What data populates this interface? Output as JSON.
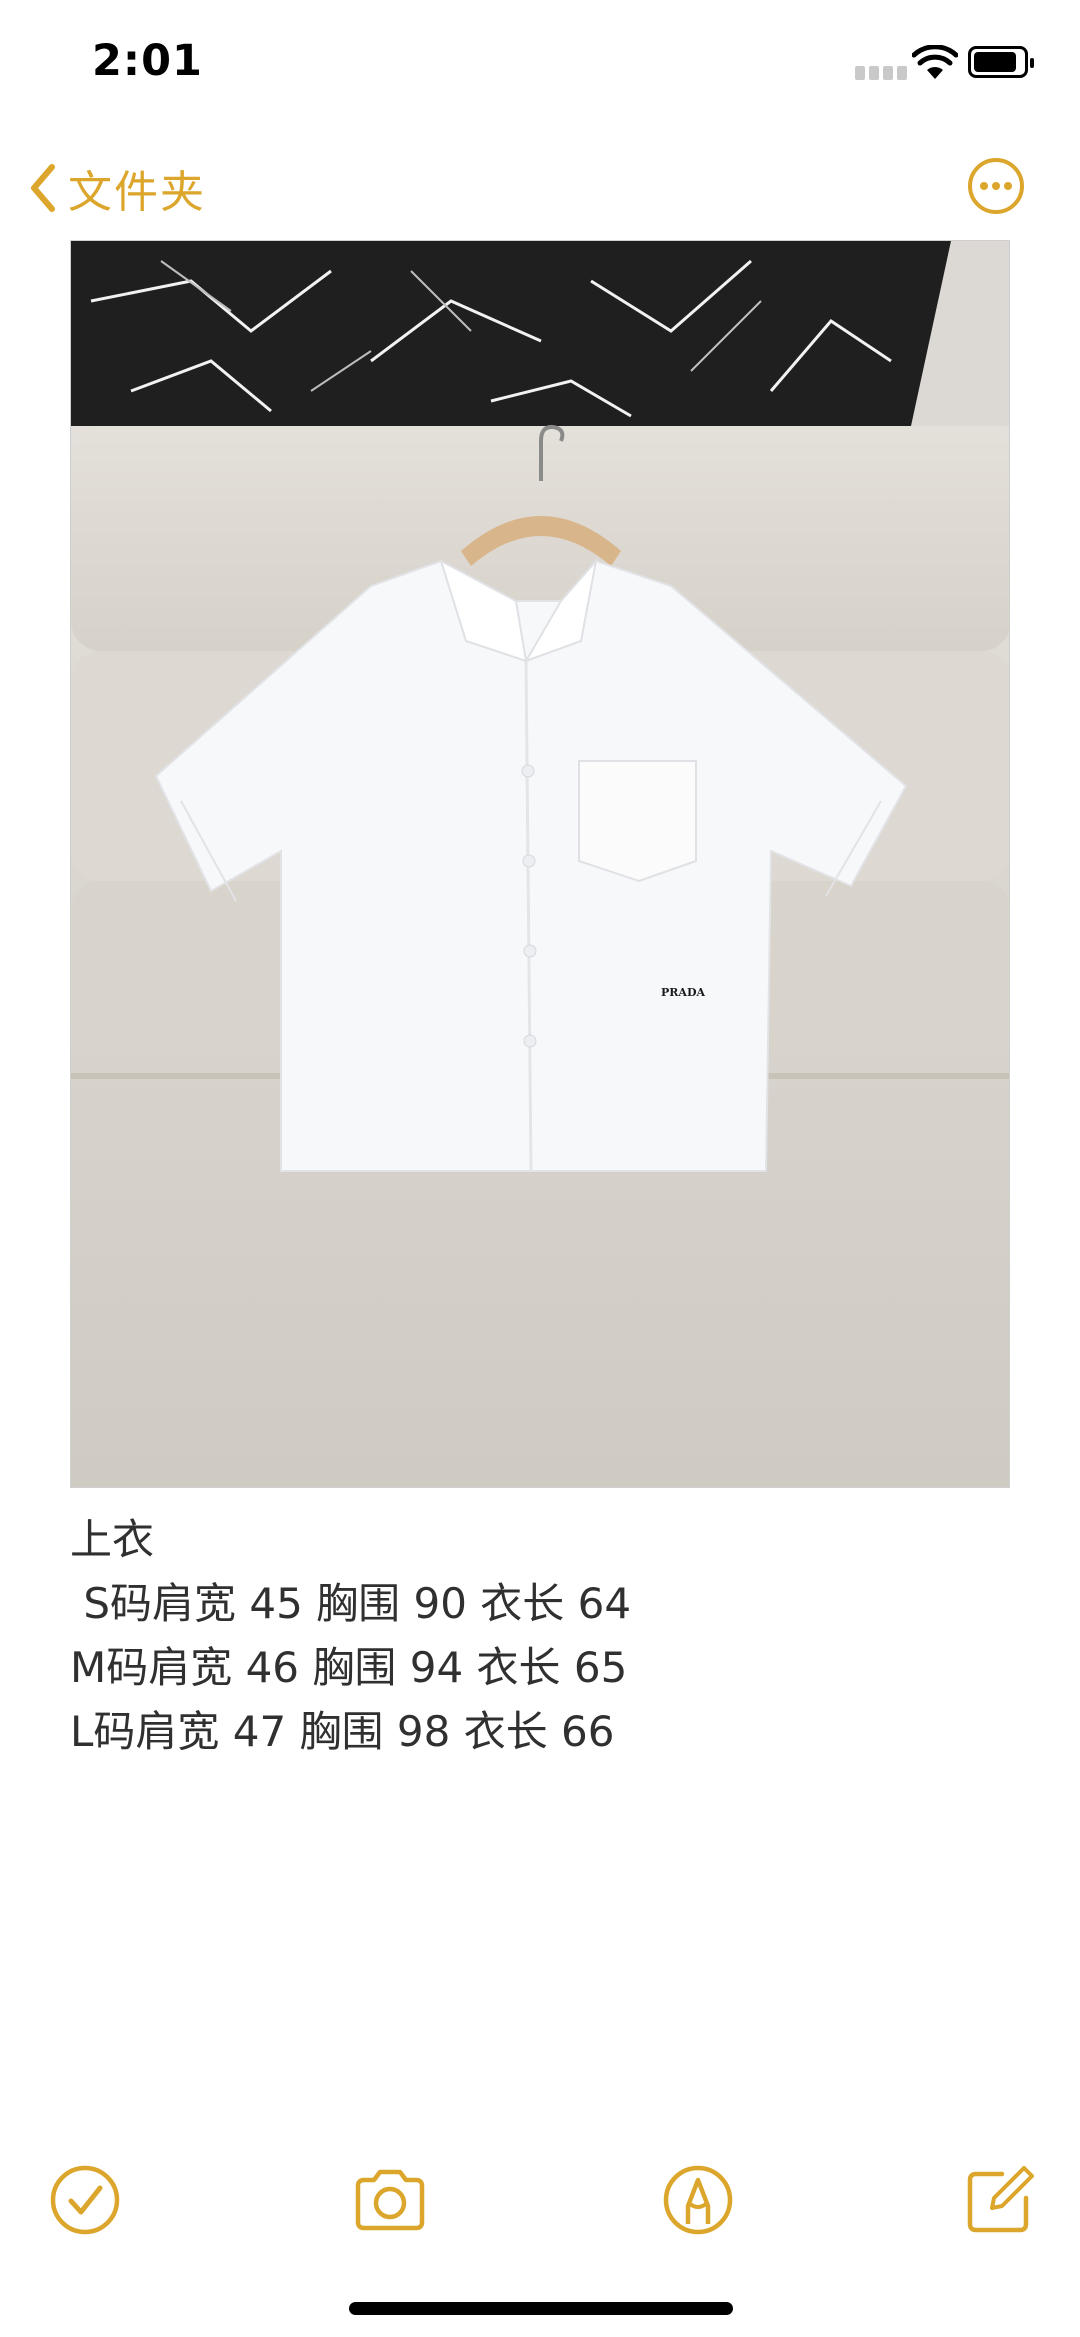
{
  "status_bar": {
    "time": "2:01"
  },
  "nav": {
    "back_label": "文件夹"
  },
  "note": {
    "image_logo_text": "PRADA",
    "lines": [
      "上衣",
      " S码肩宽 45 胸围 90 衣长 64",
      "M码肩宽 46 胸围 94 衣长 65",
      "L码肩宽 47 胸围 98 衣长 66"
    ]
  },
  "colors": {
    "accent": "#dba62b",
    "text": "#303030",
    "background": "#ffffff"
  },
  "toolbar": {
    "icons": [
      "checklist-icon",
      "camera-icon",
      "markup-icon",
      "compose-icon"
    ]
  }
}
